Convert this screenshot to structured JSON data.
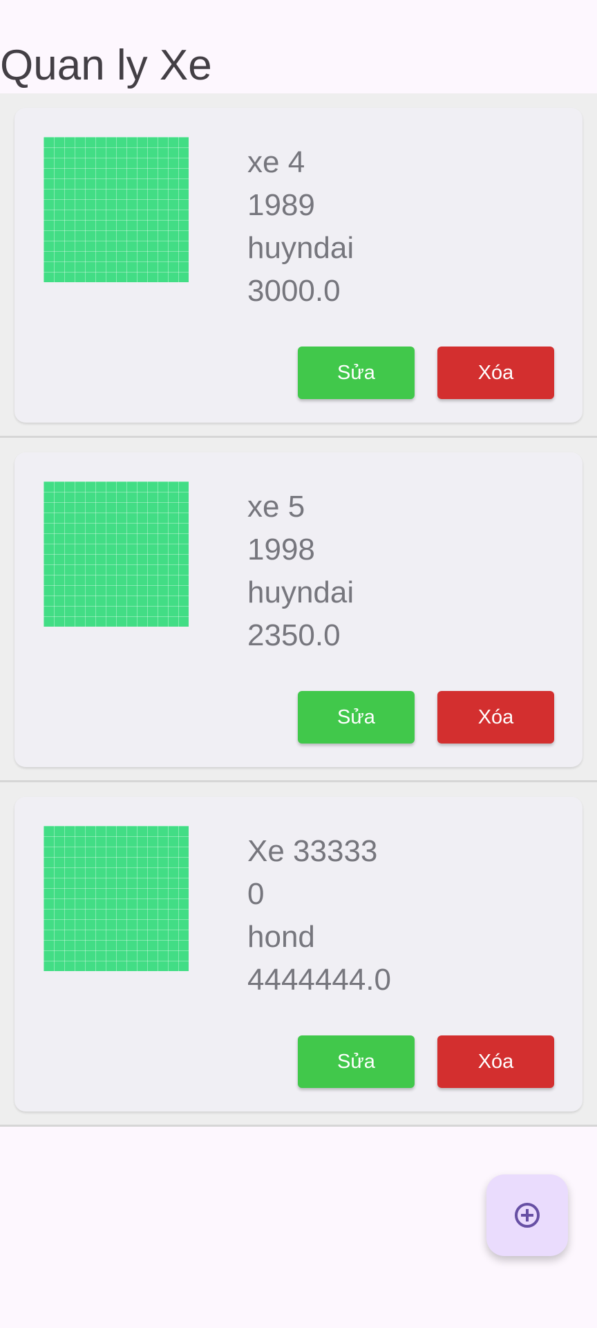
{
  "app": {
    "title": "Quan ly Xe"
  },
  "vehicles": [
    {
      "name": "xe 4",
      "year": "1989",
      "brand": "huyndai",
      "price": "3000.0",
      "edit_label": "Sửa",
      "delete_label": "Xóa"
    },
    {
      "name": "xe 5",
      "year": "1998",
      "brand": "huyndai",
      "price": "2350.0",
      "edit_label": "Sửa",
      "delete_label": "Xóa"
    },
    {
      "name": "Xe 33333",
      "year": "0",
      "brand": "hond",
      "price": "4444444.0",
      "edit_label": "Sửa",
      "delete_label": "Xóa"
    }
  ],
  "fab": {
    "icon": "add-circle-icon"
  },
  "colors": {
    "background": "#fdf7fe",
    "card": "#f0eff4",
    "image_placeholder": "#42dd85",
    "edit_button": "#41c84b",
    "delete_button": "#d32f2f",
    "fab_background": "#eadcfd",
    "fab_icon": "#6750a4"
  }
}
